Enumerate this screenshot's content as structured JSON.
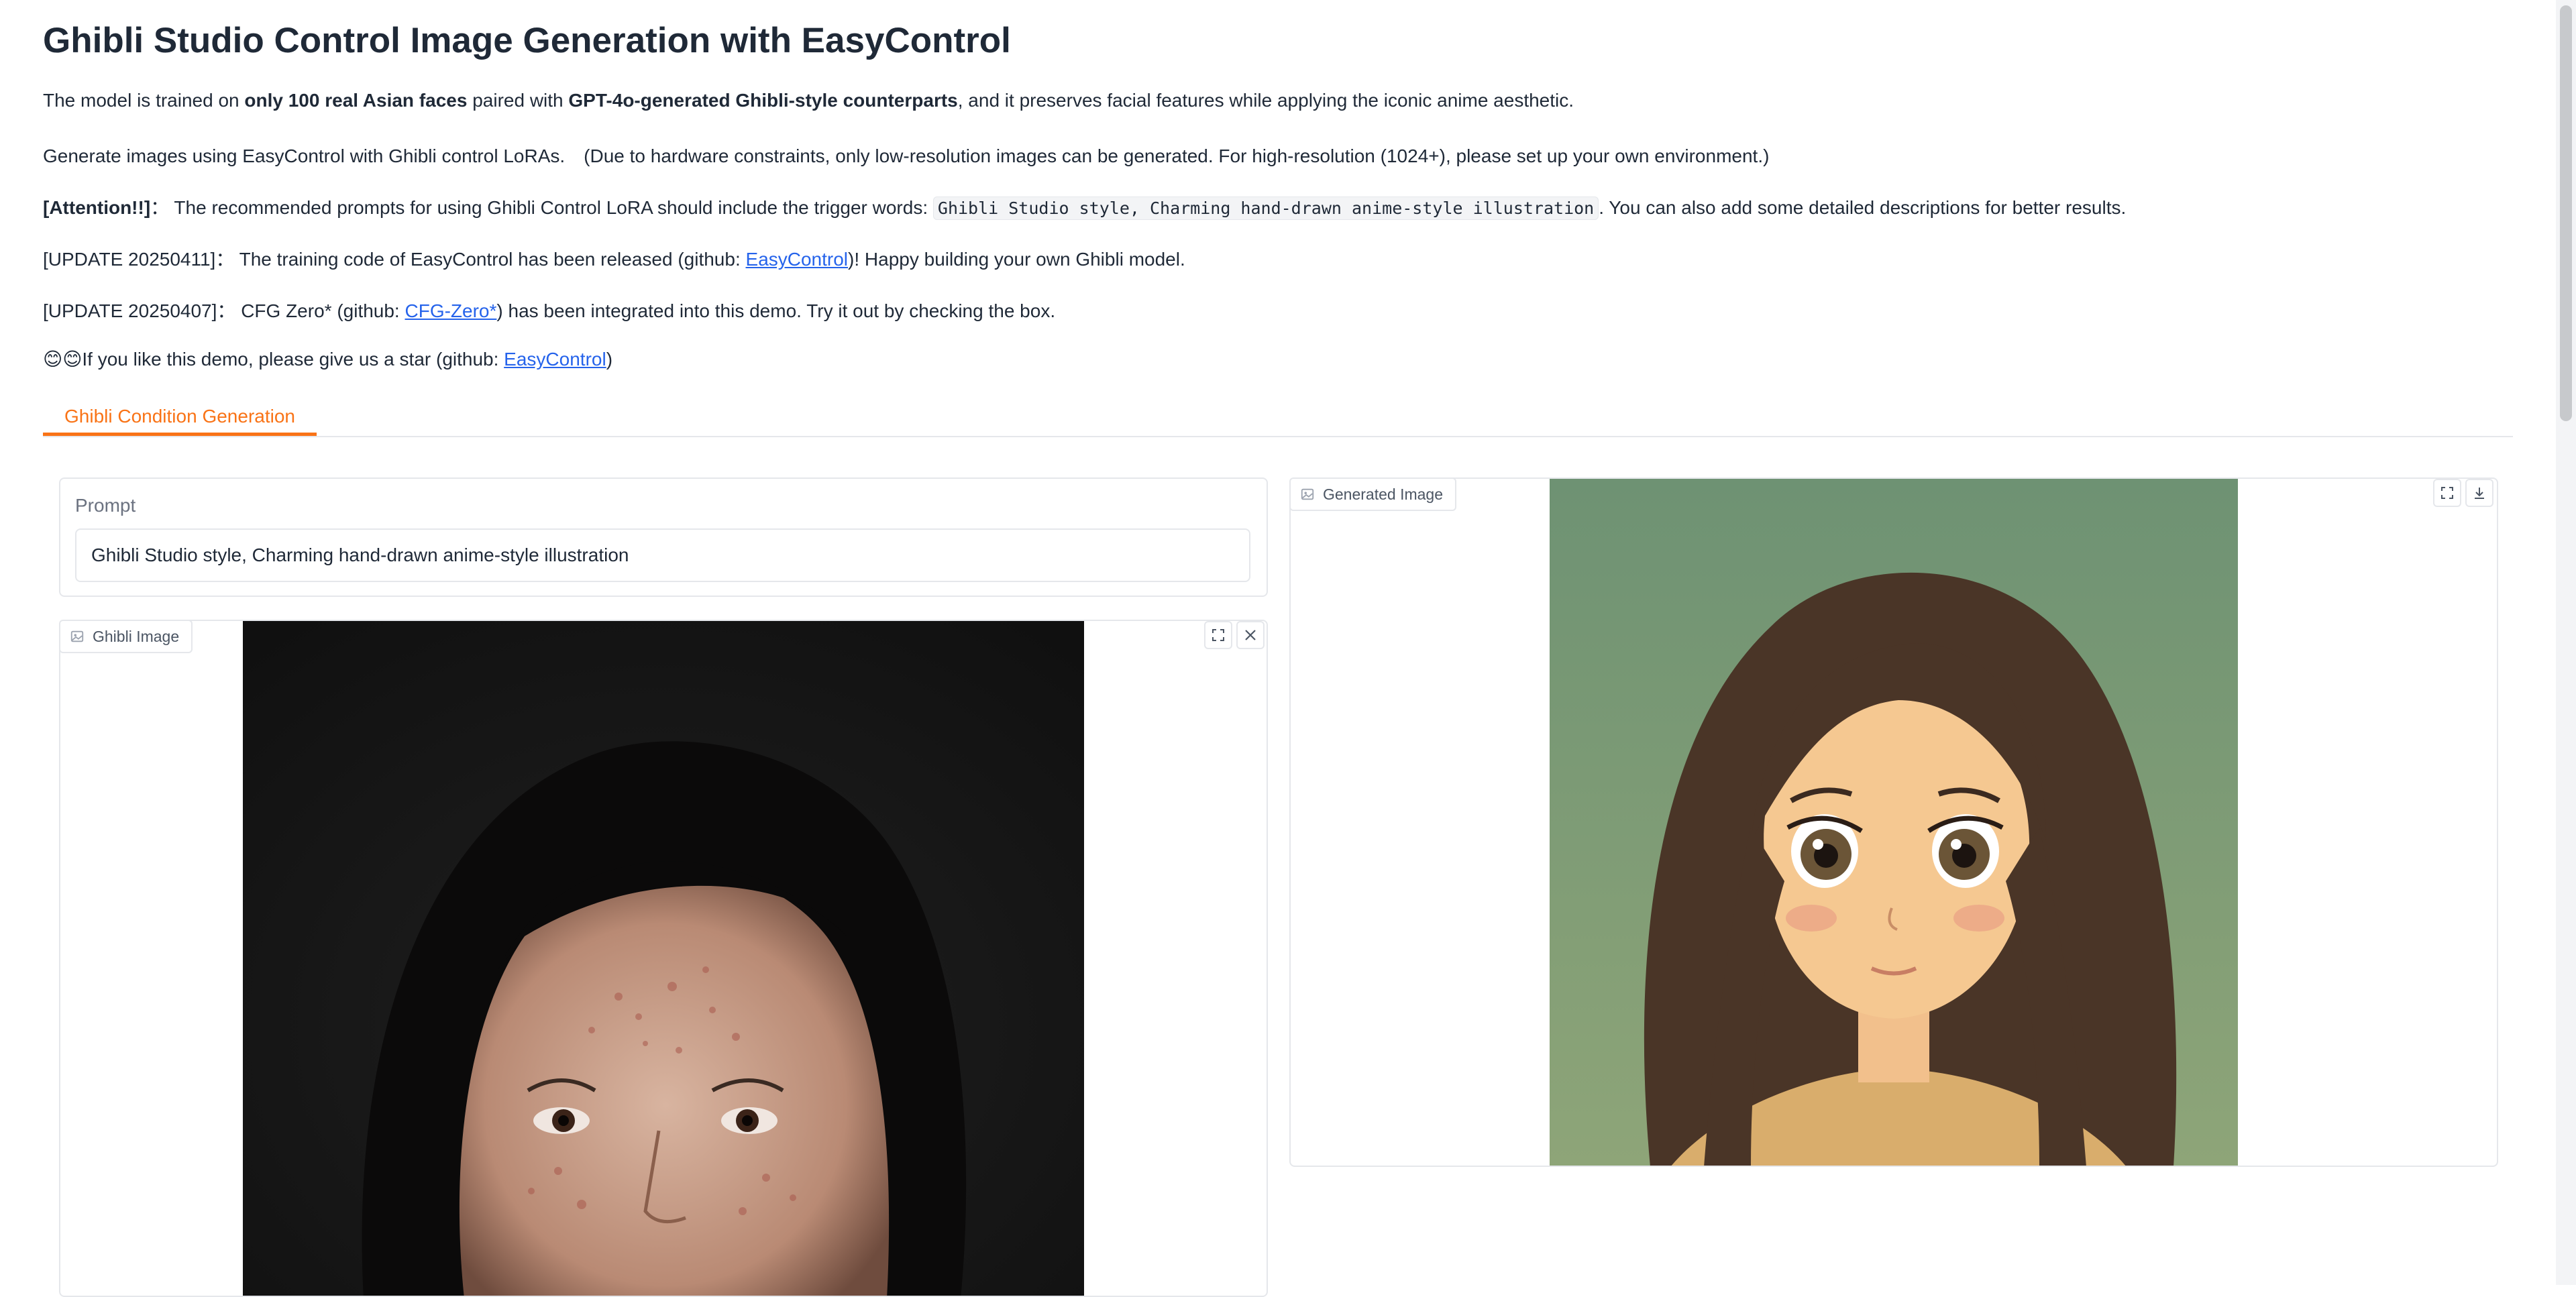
{
  "page": {
    "title": "Ghibli Studio Control Image Generation with EasyControl",
    "intro": {
      "t1": "The model is trained on ",
      "b1": "only 100 real Asian faces",
      "t2": " paired with ",
      "b2": "GPT-4o-generated Ghibli-style counterparts",
      "t3": ", and it preserves facial features while applying the iconic anime aesthetic."
    },
    "generate_note": "Generate images using EasyControl with Ghibli control LoRAs.　(Due to hardware constraints, only low-resolution images can be generated. For high-resolution (1024+), please set up your own environment.)",
    "attention": {
      "label": "[Attention!!]",
      "t1": "： The recommended prompts for using Ghibli Control LoRA should include the trigger words: ",
      "code": "Ghibli Studio style, Charming hand-drawn anime-style illustration",
      "t2": ". You can also add some detailed descriptions for better results."
    },
    "update1": {
      "t1": "[UPDATE 20250411]： The training code of EasyControl has been released (github: ",
      "link": "EasyControl",
      "t2": ")! Happy building your own Ghibli model."
    },
    "update2": {
      "t1": "[UPDATE 20250407]： CFG Zero* (github: ",
      "link": "CFG-Zero*",
      "t2": ") has been integrated into this demo. Try it out by checking the box."
    },
    "star": {
      "emoji": "😊😊",
      "t1": "If you like this demo, please give us a star (github: ",
      "link": "EasyControl",
      "t2": ")"
    }
  },
  "tabs": [
    {
      "label": "Ghibli Condition Generation",
      "active": true
    }
  ],
  "prompt": {
    "label": "Prompt",
    "value": "Ghibli Studio style, Charming hand-drawn anime-style illustration"
  },
  "input_image": {
    "label": "Ghibli Image",
    "icons": [
      "image-icon",
      "fullscreen-icon",
      "close-icon"
    ]
  },
  "output_image": {
    "label": "Generated Image",
    "icons": [
      "image-icon",
      "fullscreen-icon",
      "download-icon"
    ]
  },
  "colors": {
    "accent": "#f97316",
    "link": "#2563eb",
    "border": "#e5e7eb",
    "text": "#1f2937"
  }
}
